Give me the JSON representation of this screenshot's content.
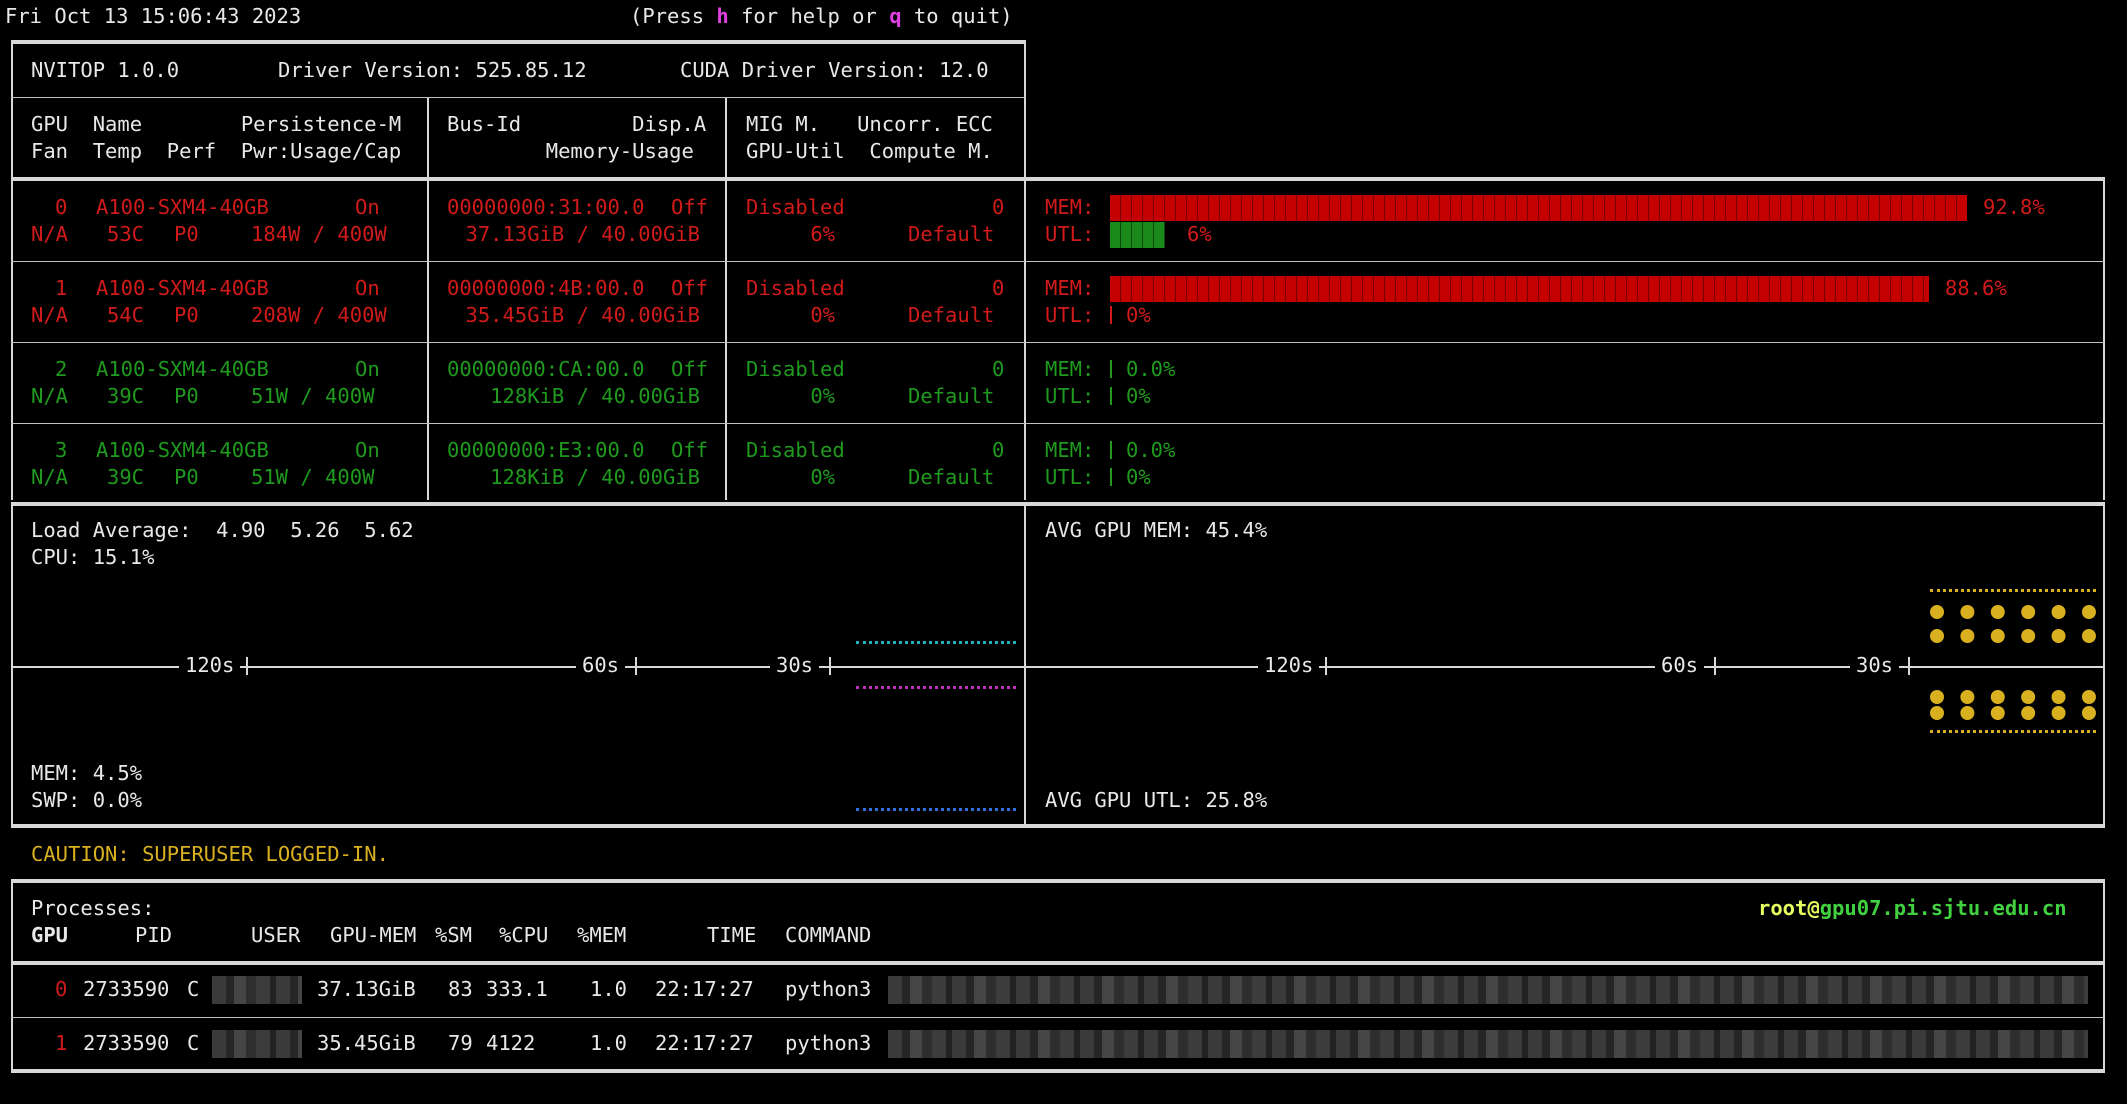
{
  "header": {
    "datetime": "Fri Oct 13 15:06:43 2023",
    "help_prefix": "(Press ",
    "help_key": "h",
    "help_mid": " for help or ",
    "quit_key": "q",
    "help_suffix": " to quit)"
  },
  "info": {
    "app": "NVITOP 1.0.0",
    "driver": "Driver Version: 525.85.12",
    "cuda": "CUDA Driver Version: 12.0"
  },
  "columns": {
    "row1_a": "GPU  Name        Persistence-M",
    "row2_a": "Fan  Temp  Perf  Pwr:Usage/Cap",
    "row1_b": "Bus-Id         Disp.A",
    "row2_b": "        Memory-Usage",
    "row1_c": "MIG M.   Uncorr. ECC",
    "row2_c": "GPU-Util  Compute M."
  },
  "gpus": [
    {
      "id": "0",
      "name": "A100-SXM4-40GB",
      "persistence": "On",
      "fan": "N/A",
      "temp": "53C",
      "perf": "P0",
      "power": "184W / 400W",
      "bus": "00000000:31:00.0",
      "disp": "Off",
      "mem_usage": "37.13GiB / 40.00GiB",
      "mig": "Disabled",
      "ecc": "0",
      "util": "6%",
      "compute": "Default",
      "mem_pct": 92.8,
      "mem_label": "92.8%",
      "util_pct": 6,
      "util_label": "6%",
      "color": "#d11a1a"
    },
    {
      "id": "1",
      "name": "A100-SXM4-40GB",
      "persistence": "On",
      "fan": "N/A",
      "temp": "54C",
      "perf": "P0",
      "power": "208W / 400W",
      "bus": "00000000:4B:00.0",
      "disp": "Off",
      "mem_usage": "35.45GiB / 40.00GiB",
      "mig": "Disabled",
      "ecc": "0",
      "util": "0%",
      "compute": "Default",
      "mem_pct": 88.6,
      "mem_label": "88.6%",
      "util_pct": 0,
      "util_label": "0%",
      "color": "#d11a1a"
    },
    {
      "id": "2",
      "name": "A100-SXM4-40GB",
      "persistence": "On",
      "fan": "N/A",
      "temp": "39C",
      "perf": "P0",
      "power": "51W / 400W",
      "bus": "00000000:CA:00.0",
      "disp": "Off",
      "mem_usage": "128KiB / 40.00GiB",
      "mig": "Disabled",
      "ecc": "0",
      "util": "0%",
      "compute": "Default",
      "mem_pct": 0.0,
      "mem_label": "0.0%",
      "util_pct": 0,
      "util_label": "0%",
      "color": "#1f9a1f"
    },
    {
      "id": "3",
      "name": "A100-SXM4-40GB",
      "persistence": "On",
      "fan": "N/A",
      "temp": "39C",
      "perf": "P0",
      "power": "51W / 400W",
      "bus": "00000000:E3:00.0",
      "disp": "Off",
      "mem_usage": "128KiB / 40.00GiB",
      "mig": "Disabled",
      "ecc": "0",
      "util": "0%",
      "compute": "Default",
      "mem_pct": 0.0,
      "mem_label": "0.0%",
      "util_pct": 0,
      "util_label": "0%",
      "color": "#1f9a1f"
    }
  ],
  "bar_labels": {
    "mem": "MEM:",
    "utl": "UTL:"
  },
  "host": {
    "load_label": "Load Average:",
    "load_1": "4.90",
    "load_5": "5.26",
    "load_15": "5.62",
    "cpu": "CPU: 15.1%",
    "mem": "MEM: 4.5%",
    "swp": "SWP: 0.0%",
    "ticks": [
      "120s",
      "60s",
      "30s"
    ]
  },
  "gpu_avg": {
    "mem": "AVG GPU MEM: 45.4%",
    "utl": "AVG GPU UTL: 25.8%",
    "ticks": [
      "120s",
      "60s",
      "30s"
    ]
  },
  "caution": "CAUTION: SUPERUSER LOGGED-IN.",
  "processes": {
    "title": "Processes:",
    "user": "root",
    "at": "@",
    "host": "gpu07.pi.sjtu.edu.cn",
    "headers": {
      "gpu": "GPU",
      "pid": "PID",
      "user": "USER",
      "gpu_mem": "GPU-MEM",
      "sm": "%SM",
      "cpu": "%CPU",
      "mem": "%MEM",
      "time": "TIME",
      "command": "COMMAND"
    },
    "rows": [
      {
        "gpu": "0",
        "pid": "2733590",
        "type": "C",
        "gpu_mem": "37.13GiB",
        "sm": "83",
        "cpu": "333.1",
        "mem": "1.0",
        "time": "22:17:27",
        "command": "python3"
      },
      {
        "gpu": "1",
        "pid": "2733590",
        "type": "C",
        "gpu_mem": "35.45GiB",
        "sm": "79",
        "cpu": "4122",
        "mem": "1.0",
        "time": "22:17:27",
        "command": "python3"
      }
    ]
  },
  "colors": {
    "red": "#d11a1a",
    "green": "#1f9a1f",
    "cyan": "#20b0c0",
    "magenta": "#c030c0",
    "blue": "#3070e0",
    "gold": "#d8b020"
  }
}
